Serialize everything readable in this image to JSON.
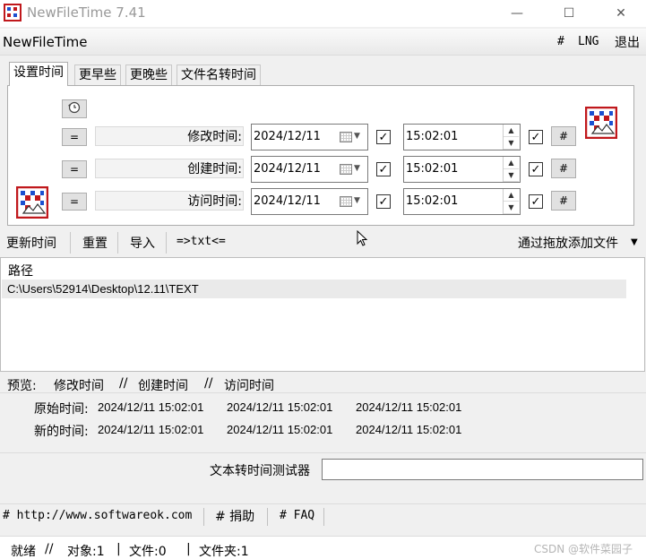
{
  "window": {
    "title": "NewFileTime 7.41",
    "minimize": "—",
    "maximize": "☐",
    "close": "✕"
  },
  "menubar": {
    "app_title": "NewFileTime",
    "hash": "#",
    "lng": "LNG",
    "exit": "退出"
  },
  "tabs": [
    {
      "label": "设置时间",
      "active": true
    },
    {
      "label": "更早些"
    },
    {
      "label": "更晚些"
    },
    {
      "label": "文件名转时间"
    }
  ],
  "panel": {
    "rows": [
      {
        "eq": "=",
        "label": "修改时间:",
        "date": "2024/12/11",
        "date_checked": true,
        "time": "15:02:01",
        "time_checked": true,
        "hash": "#"
      },
      {
        "eq": "=",
        "label": "创建时间:",
        "date": "2024/12/11",
        "date_checked": true,
        "time": "15:02:01",
        "time_checked": true,
        "hash": "#"
      },
      {
        "eq": "=",
        "label": "访问时间:",
        "date": "2024/12/11",
        "date_checked": true,
        "time": "15:02:01",
        "time_checked": true,
        "hash": "#"
      }
    ]
  },
  "toolbar": {
    "update": "更新时间",
    "reset": "重置",
    "import": "导入",
    "txt": "=>txt<=",
    "drag_add": "通过拖放添加文件",
    "drag_arrow": "▼"
  },
  "list": {
    "header": "路径",
    "rows": [
      "C:\\Users\\52914\\Desktop\\12.11\\TEXT"
    ]
  },
  "preview": {
    "label": "预览:",
    "cols": [
      "修改时间",
      "创建时间",
      "访问时间"
    ],
    "sep": "//",
    "original_label": "原始时间:",
    "new_label": "新的时间:",
    "original": [
      "2024/12/11 15:02:01",
      "2024/12/11 15:02:01",
      "2024/12/11 15:02:01"
    ],
    "new": [
      "2024/12/11 15:02:01",
      "2024/12/11 15:02:01",
      "2024/12/11 15:02:01"
    ]
  },
  "tester": {
    "label": "文本转时间测试器",
    "value": ""
  },
  "links": {
    "site": "# http://www.softwareok.com",
    "donate": "# 捐助",
    "faq": "# FAQ"
  },
  "status": {
    "ready": "就绪",
    "sep": "//",
    "objects": "对象:1",
    "files": "文件:0",
    "folders": "文件夹:1",
    "watermark": "CSDN @软件菜园子"
  },
  "colors": {
    "accent_red": "#c0181c",
    "icon_blue": "#1a4fd0",
    "panel_bg": "#ffffff",
    "window_bg": "#f0f0f0"
  }
}
